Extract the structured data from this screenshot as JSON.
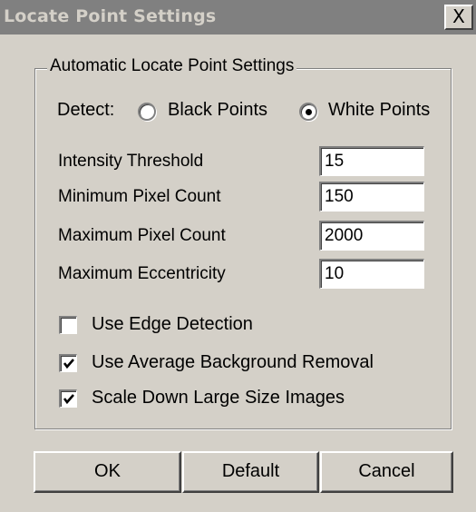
{
  "window": {
    "title": "Locate Point Settings",
    "close_label": "X"
  },
  "group": {
    "legend": "Automatic Locate Point Settings"
  },
  "detect": {
    "label": "Detect:",
    "options": [
      {
        "label": "Black Points",
        "selected": false
      },
      {
        "label": "White Points",
        "selected": true
      }
    ]
  },
  "fields": [
    {
      "label": "Intensity Threshold",
      "value": "15"
    },
    {
      "label": "Minimum Pixel Count",
      "value": "150"
    },
    {
      "label": "Maximum Pixel Count",
      "value": "2000"
    },
    {
      "label": "Maximum Eccentricity",
      "value": "10"
    }
  ],
  "checkboxes": [
    {
      "label": "Use Edge Detection",
      "checked": false
    },
    {
      "label": "Use Average Background Removal",
      "checked": true
    },
    {
      "label": "Scale Down Large Size Images",
      "checked": true
    }
  ],
  "buttons": {
    "ok": "OK",
    "default": "Default",
    "cancel": "Cancel"
  }
}
